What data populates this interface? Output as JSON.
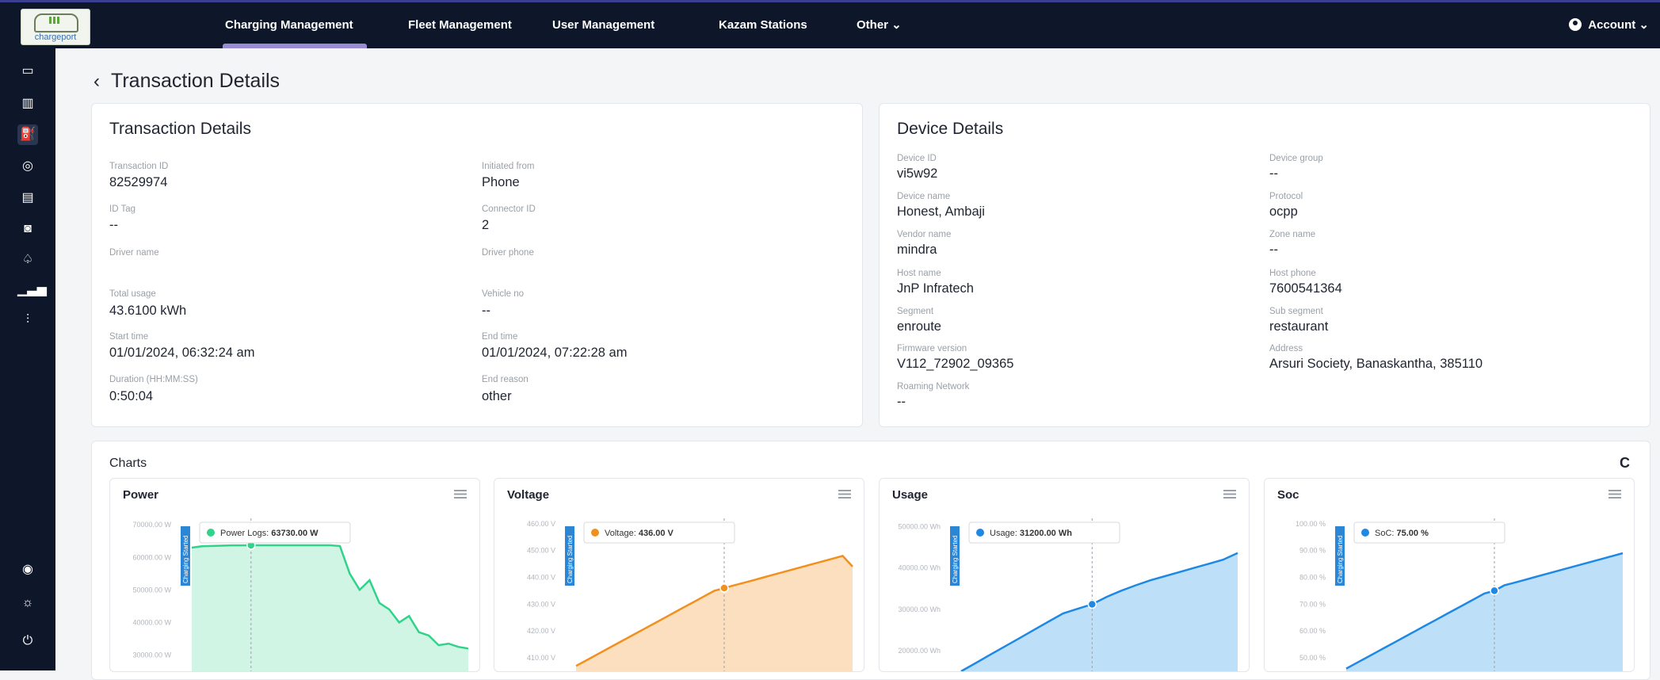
{
  "app": {
    "logo_text": "chargeport"
  },
  "nav": {
    "items": [
      "Charging Management",
      "Fleet Management",
      "User Management",
      "Kazam Stations",
      "Other ⌄"
    ],
    "active": "Charging Management",
    "account": "Account ⌄"
  },
  "sidebar": {
    "icons": [
      "monitor-icon",
      "map-icon",
      "charger-icon",
      "target-icon",
      "list-icon",
      "camera-icon",
      "bell-icon",
      "signal-icon",
      "sliders-icon",
      "eye-icon",
      "sun-icon",
      "power-icon"
    ],
    "active": "charger-icon"
  },
  "page": {
    "title": "Transaction Details",
    "back_glyph": "‹"
  },
  "transaction": {
    "title": "Transaction Details",
    "fields": [
      {
        "label": "Transaction ID",
        "value": "82529974"
      },
      {
        "label": "Initiated from",
        "value": "Phone"
      },
      {
        "label": "ID Tag",
        "value": "--"
      },
      {
        "label": "Connector ID",
        "value": "2"
      },
      {
        "label": "Driver name",
        "value": ""
      },
      {
        "label": "Driver phone",
        "value": ""
      },
      {
        "label": "Total usage",
        "value": "43.6100 kWh"
      },
      {
        "label": "Vehicle no",
        "value": "--"
      },
      {
        "label": "Start time",
        "value": "01/01/2024, 06:32:24 am"
      },
      {
        "label": "End time",
        "value": "01/01/2024, 07:22:28 am"
      },
      {
        "label": "Duration (HH:MM:SS)",
        "value": "0:50:04"
      },
      {
        "label": "End reason",
        "value": "other"
      }
    ]
  },
  "device": {
    "title": "Device Details",
    "fields": [
      {
        "label": "Device ID",
        "value": "vi5w92"
      },
      {
        "label": "Device group",
        "value": "--"
      },
      {
        "label": "Device name",
        "value": "Honest, Ambaji"
      },
      {
        "label": "Protocol",
        "value": "ocpp"
      },
      {
        "label": "Vendor name",
        "value": "mindra"
      },
      {
        "label": "Zone name",
        "value": "--"
      },
      {
        "label": "Host name",
        "value": "JnP Infratech"
      },
      {
        "label": "Host phone",
        "value": "7600541364"
      },
      {
        "label": "Segment",
        "value": "enroute"
      },
      {
        "label": "Sub segment",
        "value": "restaurant"
      },
      {
        "label": "Firmware version",
        "value": "V112_72902_09365"
      },
      {
        "label": "Address",
        "value": "Arsuri Society, Banaskantha, 385110"
      },
      {
        "label": "Roaming Network",
        "value": "--"
      }
    ]
  },
  "charts_section": {
    "title": "Charts",
    "refresh_icon": "C"
  },
  "chart_data": [
    {
      "type": "area",
      "title": "Power",
      "color": "#2fd38a",
      "fill": "#c9f3df",
      "y_ticks": [
        "70000.00 W",
        "60000.00 W",
        "50000.00 W",
        "40000.00 W",
        "30000.00 W"
      ],
      "ylim": [
        25000,
        72000
      ],
      "annotation": "Charging Started",
      "tooltip": {
        "label": "Power Logs:",
        "value": "63730.00 W"
      },
      "values": [
        63000,
        63400,
        63500,
        63600,
        63700,
        63700,
        63730,
        63730,
        63730,
        63730,
        63730,
        63730,
        63730,
        63730,
        63730,
        63500,
        55000,
        50000,
        53000,
        46000,
        44000,
        40000,
        42000,
        37000,
        36000,
        33000,
        33500,
        32500,
        32000
      ]
    },
    {
      "type": "area",
      "title": "Voltage",
      "color": "#f2901e",
      "fill": "#fbd9b3",
      "y_ticks": [
        "460.00 V",
        "450.00 V",
        "440.00 V",
        "430.00 V",
        "420.00 V",
        "410.00 V"
      ],
      "ylim": [
        405,
        462
      ],
      "annotation": "Charging Started",
      "tooltip": {
        "label": "Voltage:",
        "value": "436.00 V"
      },
      "values": [
        407,
        409,
        411,
        413,
        415,
        417,
        419,
        421,
        423,
        425,
        427,
        429,
        431,
        433,
        435,
        436,
        437,
        438,
        439,
        440,
        441,
        442,
        443,
        444,
        445,
        446,
        447,
        448,
        444
      ]
    },
    {
      "type": "area",
      "title": "Usage",
      "color": "#1e88e5",
      "fill": "#b3d9f7",
      "y_ticks": [
        "50000.00 Wh",
        "40000.00 Wh",
        "30000.00 Wh",
        "20000.00 Wh"
      ],
      "ylim": [
        15000,
        52000
      ],
      "annotation": "Charging Started",
      "tooltip": {
        "label": "Usage:",
        "value": "31200.00 Wh"
      },
      "values": [
        15000,
        17000,
        19000,
        21000,
        23000,
        25000,
        27000,
        29000,
        30100,
        31200,
        33000,
        34500,
        35800,
        37000,
        38000,
        39000,
        40000,
        41000,
        42000,
        43600
      ]
    },
    {
      "type": "area",
      "title": "Soc",
      "color": "#1e88e5",
      "fill": "#b3d9f7",
      "y_ticks": [
        "100.00 %",
        "90.00 %",
        "80.00 %",
        "70.00 %",
        "60.00 %",
        "50.00 %"
      ],
      "ylim": [
        45,
        102
      ],
      "annotation": "Charging Started",
      "tooltip": {
        "label": "SoC:",
        "value": "75.00 %"
      },
      "values": [
        46,
        48,
        50,
        52,
        54,
        56,
        58,
        60,
        62,
        64,
        66,
        68,
        70,
        72,
        74,
        75,
        77,
        78,
        79,
        80,
        81,
        82,
        83,
        84,
        85,
        86,
        87,
        88,
        89
      ]
    }
  ]
}
